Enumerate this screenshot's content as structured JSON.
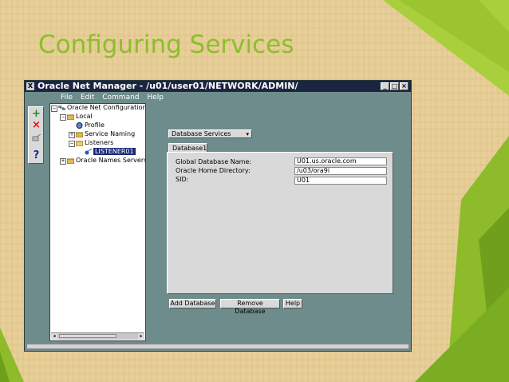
{
  "slide": {
    "title": "Configuring Services"
  },
  "colors": {
    "title_green": "#8bbf2c",
    "titlebar": "#1b2540",
    "window_bg": "#6f8c8c",
    "selection": "#1b2a78"
  },
  "window": {
    "title": "Oracle Net Manager - /u01/user01/NETWORK/ADMIN/",
    "sys_icon": "X",
    "minimize": "_",
    "maximize": "□",
    "close": "×"
  },
  "menu": {
    "file": "File",
    "edit": "Edit",
    "command": "Command",
    "help": "Help"
  },
  "toolbar": {
    "add": "+",
    "remove": "×",
    "help": "?"
  },
  "tree": {
    "root": "Oracle Net Configuration",
    "local": "Local",
    "profile": "Profile",
    "service_naming": "Service Naming",
    "listeners": "Listeners",
    "listener01": "LISTENER01",
    "oracle_names_servers": "Oracle Names Servers"
  },
  "content": {
    "dropdown_value": "Database Services",
    "tab_label": "Database1",
    "fields": {
      "global_db_name_label": "Global Database Name:",
      "global_db_name_value": "U01.us.oracle.com",
      "oracle_home_label": "Oracle Home Directory:",
      "oracle_home_value": "/u03/ora9i",
      "sid_label": "SID:",
      "sid_value": "U01"
    },
    "buttons": {
      "add_database": "Add Database",
      "remove_database": "Remove Database",
      "help": "Help"
    }
  }
}
